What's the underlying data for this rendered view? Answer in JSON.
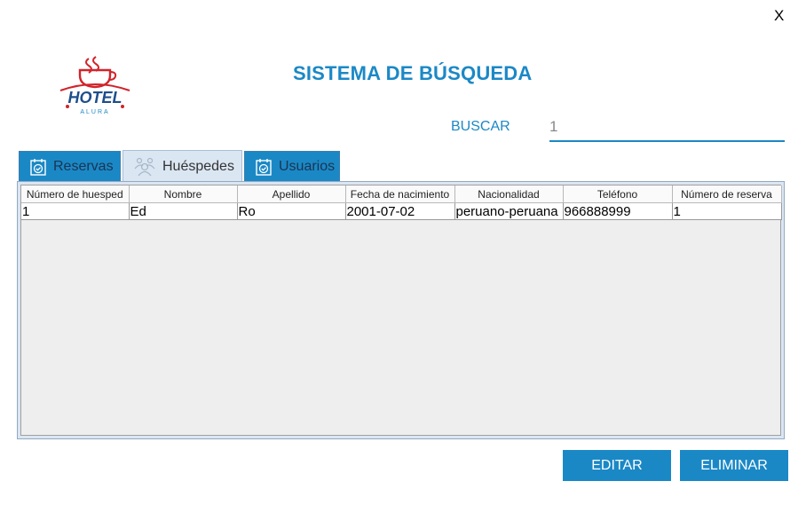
{
  "window": {
    "close_label": "X"
  },
  "header": {
    "title": "SISTEMA DE BÚSQUEDA",
    "logo_text": "HOTEL",
    "logo_subtext": "ALURA"
  },
  "search": {
    "label": "BUSCAR",
    "value": "1"
  },
  "tabs": [
    {
      "label": "Reservas",
      "icon": "calendar-check-icon",
      "active": false
    },
    {
      "label": "Huéspedes",
      "icon": "guests-icon",
      "active": true
    },
    {
      "label": "Usuarios",
      "icon": "calendar-check-icon",
      "active": false
    }
  ],
  "table": {
    "columns": [
      "Número de huesped",
      "Nombre",
      "Apellido",
      "Fecha de nacimiento",
      "Nacionalidad",
      "Teléfono",
      "Número de reserva"
    ],
    "rows": [
      [
        "1",
        "Ed",
        "Ro",
        "2001-07-02",
        "peruano-peruana",
        "966888999",
        "1"
      ]
    ]
  },
  "buttons": {
    "edit": "EDITAR",
    "delete": "ELIMINAR"
  },
  "colors": {
    "accent": "#1b88c6",
    "logo_red": "#d2232a",
    "panel_bg": "#dbe6f3"
  }
}
